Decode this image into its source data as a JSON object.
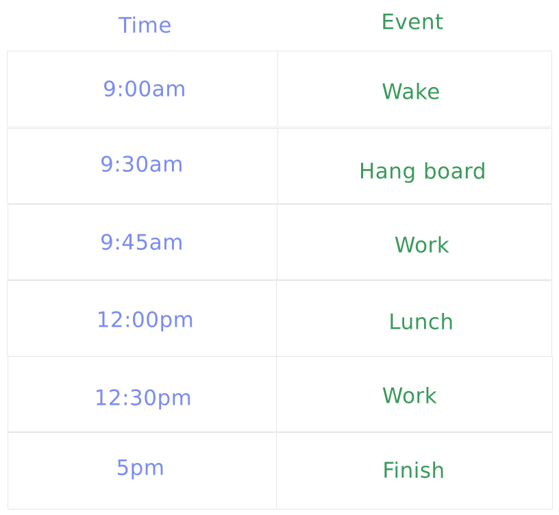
{
  "colors": {
    "time": "#7b8cf0",
    "event": "#3a9a5b",
    "border": "#e6e6e6"
  },
  "headers": {
    "time": "Time",
    "event": "Event"
  },
  "rows": [
    {
      "time": "9:00am",
      "event": "Wake"
    },
    {
      "time": "9:30am",
      "event": "Hang board"
    },
    {
      "time": "9:45am",
      "event": "Work"
    },
    {
      "time": "12:00pm",
      "event": "Lunch"
    },
    {
      "time": "12:30pm",
      "event": "Work"
    },
    {
      "time": "5pm",
      "event": "Finish"
    }
  ]
}
